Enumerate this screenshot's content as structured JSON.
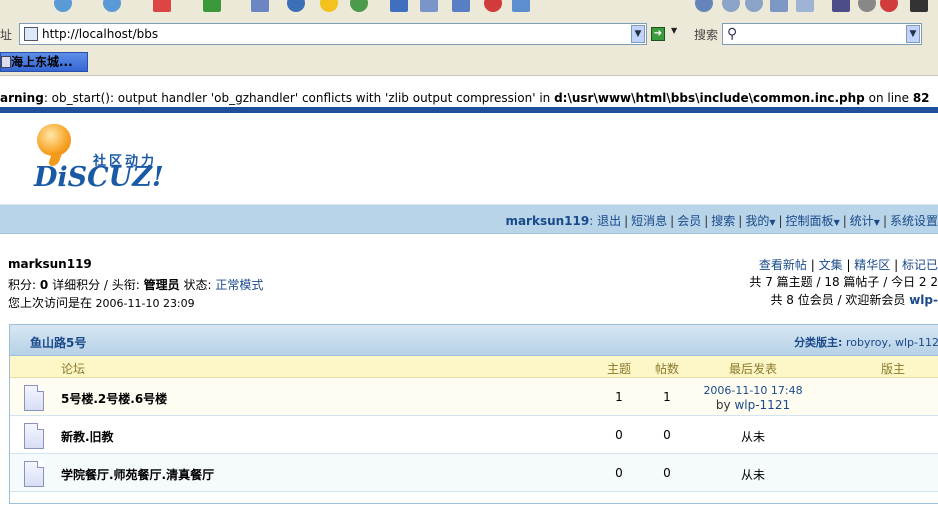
{
  "browser": {
    "address_label": "址",
    "url": "http://localhost/bbs",
    "search_label": "搜索",
    "link_button": "海上东城..."
  },
  "warning": {
    "prefix": "arning",
    "message": ": ob_start(): output handler 'ob_gzhandler' conflicts with 'zlib output compression' in ",
    "path": "d:\\usr\\www\\html\\bbs\\include\\common.inc.php",
    "on_line": " on line ",
    "line": "82"
  },
  "logo": {
    "subtitle": "社区动力",
    "text": "DiSCUZ!"
  },
  "nav": {
    "user": "marksun119",
    "items": [
      "退出",
      "短消息",
      "会员",
      "搜索",
      "我的",
      "控制面板",
      "统计",
      "系统设置"
    ]
  },
  "user_info": {
    "name": "marksun119",
    "credits_label": "积分:",
    "credits": "0",
    "credits_detail": "详细积分",
    "title_label": "/ 头衔:",
    "title": "管理员",
    "status_label": "状态:",
    "status": "正常模式",
    "last_visit_label": "您上次访问是在",
    "last_visit": "2006-11-10 23:09",
    "right_links": [
      "查看新帖",
      "文集",
      "精华区",
      "标记已"
    ],
    "stats_line": "共 7 篇主题 / 18 篇帖子 / 今日 2 2",
    "members_line": "共 8 位会员 / 欢迎新会员",
    "new_member": "wlp-"
  },
  "category": {
    "title": "鱼山路5号",
    "mods_label": "分类版主:",
    "mods": "robyroy, wlp-112"
  },
  "columns": {
    "forum": "论坛",
    "topics": "主题",
    "posts": "帖数",
    "last_post": "最后发表",
    "moderator": "版主"
  },
  "forums": [
    {
      "name": "5号楼.2号楼.6号楼",
      "topics": "1",
      "posts": "1",
      "last_date": "2006-11-10 17:48",
      "by_label": "by",
      "last_user": "wlp-1121"
    },
    {
      "name": "新教.旧教",
      "topics": "0",
      "posts": "0",
      "never": "从未"
    },
    {
      "name": "学院餐厅.师苑餐厅.清真餐厅",
      "topics": "0",
      "posts": "0",
      "never": "从未"
    }
  ]
}
